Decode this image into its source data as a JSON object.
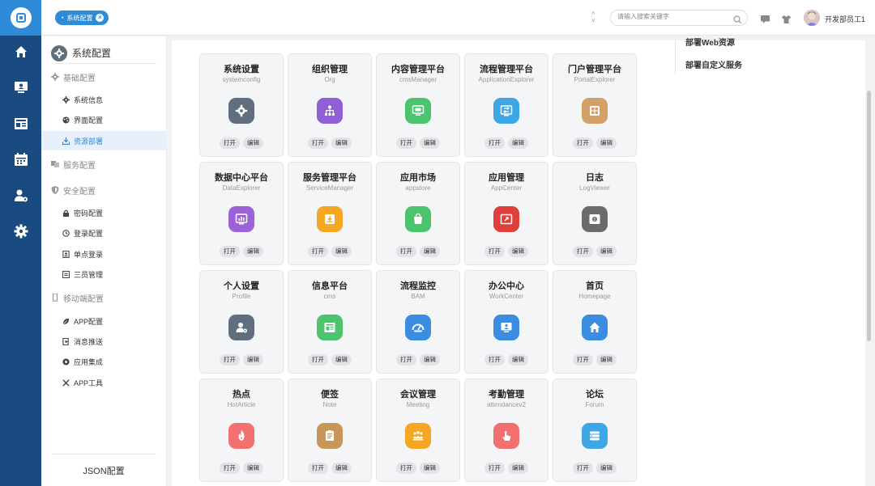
{
  "header": {
    "tab_label": "系统配置",
    "search_placeholder": "请输入搜索关键字",
    "user_name": "开发部员工1"
  },
  "sidebar": {
    "title": "系统配置",
    "groups": [
      {
        "label": "基础配置",
        "icon": "gear-icon"
      },
      {
        "label": "服务配置",
        "icon": "service-icon"
      },
      {
        "label": "安全配置",
        "icon": "shield-icon"
      },
      {
        "label": "移动端配置",
        "icon": "mobile-icon"
      }
    ],
    "items": [
      {
        "label": "系统信息",
        "icon": "gear-icon"
      },
      {
        "label": "界面配置",
        "icon": "palette-icon"
      },
      {
        "label": "资源部署",
        "icon": "deploy-icon"
      },
      {
        "label": "密码配置",
        "icon": "lock-icon"
      },
      {
        "label": "登录配置",
        "icon": "login-icon"
      },
      {
        "label": "单点登录",
        "icon": "sso-icon"
      },
      {
        "label": "三员管理",
        "icon": "admin-icon"
      },
      {
        "label": "APP配置",
        "icon": "leaf-icon"
      },
      {
        "label": "消息推送",
        "icon": "push-icon"
      },
      {
        "label": "应用集成",
        "icon": "integration-icon"
      },
      {
        "label": "APP工具",
        "icon": "tools-icon"
      }
    ],
    "footer_label": "JSON配置"
  },
  "right_panel": {
    "lines": [
      "部署Web资源",
      "部署自定义服务"
    ]
  },
  "buttons": {
    "open": "打开",
    "edit": "编辑"
  },
  "apps": [
    {
      "title": "系统设置",
      "sub": "systemconfig",
      "color": "#5f6f7e",
      "icon": "gear-icon"
    },
    {
      "title": "组织管理",
      "sub": "Org",
      "color": "#8e5fd6",
      "icon": "org-icon"
    },
    {
      "title": "内容管理平台",
      "sub": "cmsManager",
      "color": "#4cc46e",
      "icon": "monitor-icon"
    },
    {
      "title": "流程管理平台",
      "sub": "ApplicationExplorer",
      "color": "#3fa6e6",
      "icon": "flow-icon"
    },
    {
      "title": "门户管理平台",
      "sub": "PortalExplorer",
      "color": "#d4a067",
      "icon": "portal-icon"
    },
    {
      "title": "数据中心平台",
      "sub": "DataExplorer",
      "color": "#9b62d9",
      "icon": "chart-icon"
    },
    {
      "title": "服务管理平台",
      "sub": "ServiceManager",
      "color": "#f5a623",
      "icon": "service-icon"
    },
    {
      "title": "应用市场",
      "sub": "appstore",
      "color": "#4cc46e",
      "icon": "bag-icon"
    },
    {
      "title": "应用管理",
      "sub": "AppCenter",
      "color": "#e0403c",
      "icon": "app-icon"
    },
    {
      "title": "日志",
      "sub": "LogViewer",
      "color": "#6b6b6b",
      "icon": "log-icon"
    },
    {
      "title": "个人设置",
      "sub": "Profile",
      "color": "#5f6f7e",
      "icon": "profile-icon"
    },
    {
      "title": "信息平台",
      "sub": "cms",
      "color": "#4cc46e",
      "icon": "news-icon"
    },
    {
      "title": "流程监控",
      "sub": "BAM",
      "color": "#3a8de0",
      "icon": "gauge-icon"
    },
    {
      "title": "办公中心",
      "sub": "WorkCenter",
      "color": "#3a8de0",
      "icon": "desk-icon"
    },
    {
      "title": "首页",
      "sub": "Homepage",
      "color": "#3a8de0",
      "icon": "home-icon"
    },
    {
      "title": "热点",
      "sub": "HotArticle",
      "color": "#f2706f",
      "icon": "fire-icon"
    },
    {
      "title": "便签",
      "sub": "Note",
      "color": "#c9965a",
      "icon": "note-icon"
    },
    {
      "title": "会议管理",
      "sub": "Meeting",
      "color": "#f5a623",
      "icon": "meeting-icon"
    },
    {
      "title": "考勤管理",
      "sub": "attendancev2",
      "color": "#f2706f",
      "icon": "hand-icon"
    },
    {
      "title": "论坛",
      "sub": "Forum",
      "color": "#3fa6e6",
      "icon": "forum-icon"
    }
  ]
}
